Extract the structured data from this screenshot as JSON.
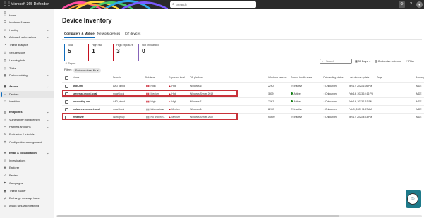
{
  "topbar": {
    "app_title": "Microsoft 365 Defender",
    "search_placeholder": "Search",
    "waffle_icon": "waffle-icon",
    "settings_icon": "gear-icon",
    "help_icon": "help-icon",
    "avatar_icon": "avatar-icon",
    "rainbow_colors": [
      "#ff4fa3",
      "#ff9a3c",
      "#ffd83d",
      "#47c96b",
      "#2fa8e8",
      "#7b5cff"
    ]
  },
  "sidebar": {
    "items": [
      {
        "label": "Home",
        "icon": "home-icon",
        "chevron": false
      },
      {
        "label": "Incidents & alerts",
        "icon": "shield-alert-icon",
        "chevron": true
      },
      {
        "label": "Hunting",
        "icon": "hunting-icon",
        "chevron": true
      },
      {
        "label": "Actions & submissions",
        "icon": "actions-icon",
        "chevron": true
      },
      {
        "label": "Threat analytics",
        "icon": "analytics-icon",
        "chevron": false
      },
      {
        "label": "Secure score",
        "icon": "score-icon",
        "chevron": false
      },
      {
        "label": "Learning hub",
        "icon": "learning-icon",
        "chevron": false
      },
      {
        "label": "Trials",
        "icon": "trials-icon",
        "chevron": false
      },
      {
        "label": "Partner catalog",
        "icon": "catalog-icon",
        "chevron": true
      },
      {
        "label": "Assets",
        "icon": "assets-icon",
        "chevron": true,
        "header": true
      },
      {
        "label": "Devices",
        "icon": "devices-icon",
        "chevron": false,
        "selected": true
      },
      {
        "label": "Identities",
        "icon": "identities-icon",
        "chevron": false
      },
      {
        "label": "Endpoints",
        "icon": "endpoints-icon",
        "chevron": true,
        "header": true
      },
      {
        "label": "Vulnerability management",
        "icon": "vulnerability-icon",
        "chevron": true
      },
      {
        "label": "Partners and APIs",
        "icon": "partners-icon",
        "chevron": true
      },
      {
        "label": "Evaluation & tutorials",
        "icon": "evaluation-icon",
        "chevron": true
      },
      {
        "label": "Configuration management",
        "icon": "config-icon",
        "chevron": false
      },
      {
        "label": "Email & collaboration",
        "icon": "email-icon",
        "chevron": true,
        "header": true
      },
      {
        "label": "Investigations",
        "icon": "investigations-icon",
        "chevron": false
      },
      {
        "label": "Explorer",
        "icon": "explorer-icon",
        "chevron": false
      },
      {
        "label": "Review",
        "icon": "review-icon",
        "chevron": false
      },
      {
        "label": "Campaigns",
        "icon": "campaigns-icon",
        "chevron": false
      },
      {
        "label": "Threat tracker",
        "icon": "tracker-icon",
        "chevron": false
      },
      {
        "label": "Exchange message trace",
        "icon": "exchange-icon",
        "chevron": false
      },
      {
        "label": "Attack simulation training",
        "icon": "simulation-icon",
        "chevron": false
      }
    ]
  },
  "main": {
    "title": "Device Inventory",
    "tabs": [
      {
        "label": "Computers & Mobile",
        "active": true
      },
      {
        "label": "Network devices",
        "active": false
      },
      {
        "label": "IoT devices",
        "active": false
      }
    ],
    "stats": [
      {
        "label": "Total",
        "value": "5",
        "color": "#0f6cbd"
      },
      {
        "label": "High risk",
        "value": "1",
        "color": "#c50f1f"
      },
      {
        "label": "High exposure",
        "value": "3",
        "color": "#c50f1f"
      },
      {
        "label": "Not onboarded",
        "value": "0",
        "color": "#8764b8"
      }
    ],
    "toolbar": {
      "export_label": "Export",
      "filters_label": "Filters:",
      "filter_chip": "Exclusion state: No",
      "search_placeholder": "Search",
      "days_label": "30 Days",
      "customize_label": "Customize columns",
      "filter_label": "Filter"
    },
    "columns": [
      "Name",
      "Domain",
      "Risk level",
      "Exposure level",
      "OS platform",
      "Windows version",
      "Sensor health state",
      "Onboarding status",
      "Last device update",
      "Tags",
      "Manag"
    ],
    "rows": [
      {
        "name": "andy-vm",
        "domain": "AAD joined",
        "risk": "High",
        "exposure": "High",
        "os": "Windows 10",
        "win": "22H2",
        "health": "Inactive",
        "health_color": "#c7c7c7",
        "onboarding": "Onboarded",
        "updated": "Jan 17, 2023 1:06 PM",
        "manag": "MDE"
      },
      {
        "name": "server-ad.mocrt.local",
        "domain": "mocrt.local",
        "risk": "Medium",
        "exposure": "High",
        "os": "Windows Server 2019",
        "win": "1809",
        "health": "Active",
        "health_color": "#107c10",
        "onboarding": "Onboarded",
        "updated": "Feb 14, 2023 10:16 PM",
        "manag": "MDE"
      },
      {
        "name": "accounting-vm",
        "domain": "AAD joined",
        "risk": "High",
        "exposure": "High",
        "os": "Windows 11",
        "win": "22H2",
        "health": "Active",
        "health_color": "#107c10",
        "onboarding": "Onboarded",
        "updated": "Feb 14, 2023 1:19 PM",
        "manag": "MDE"
      },
      {
        "name": "malware-vm.mocrt.local",
        "domain": "mocrt.local",
        "risk": "Informational",
        "exposure": "Medium",
        "os": "Windows 10",
        "win": "22H2",
        "health": "Inactive",
        "health_color": "#c7c7c7",
        "onboarding": "Onboarded",
        "updated": "Feb 9, 2023 11:57 AM",
        "manag": "MDE"
      },
      {
        "name": "winserver",
        "domain": "Workgroup",
        "risk": "No known ri...",
        "exposure": "Medium",
        "os": "Windows Server 2022",
        "win": "Future",
        "health": "Inactive",
        "health_color": "#c7c7c7",
        "onboarding": "Onboarded",
        "updated": "Jan 17, 2023 4:23 PM",
        "manag": "MDE"
      }
    ],
    "highlighted_rows": [
      1,
      4
    ],
    "highlight_color": "#c8323a"
  }
}
